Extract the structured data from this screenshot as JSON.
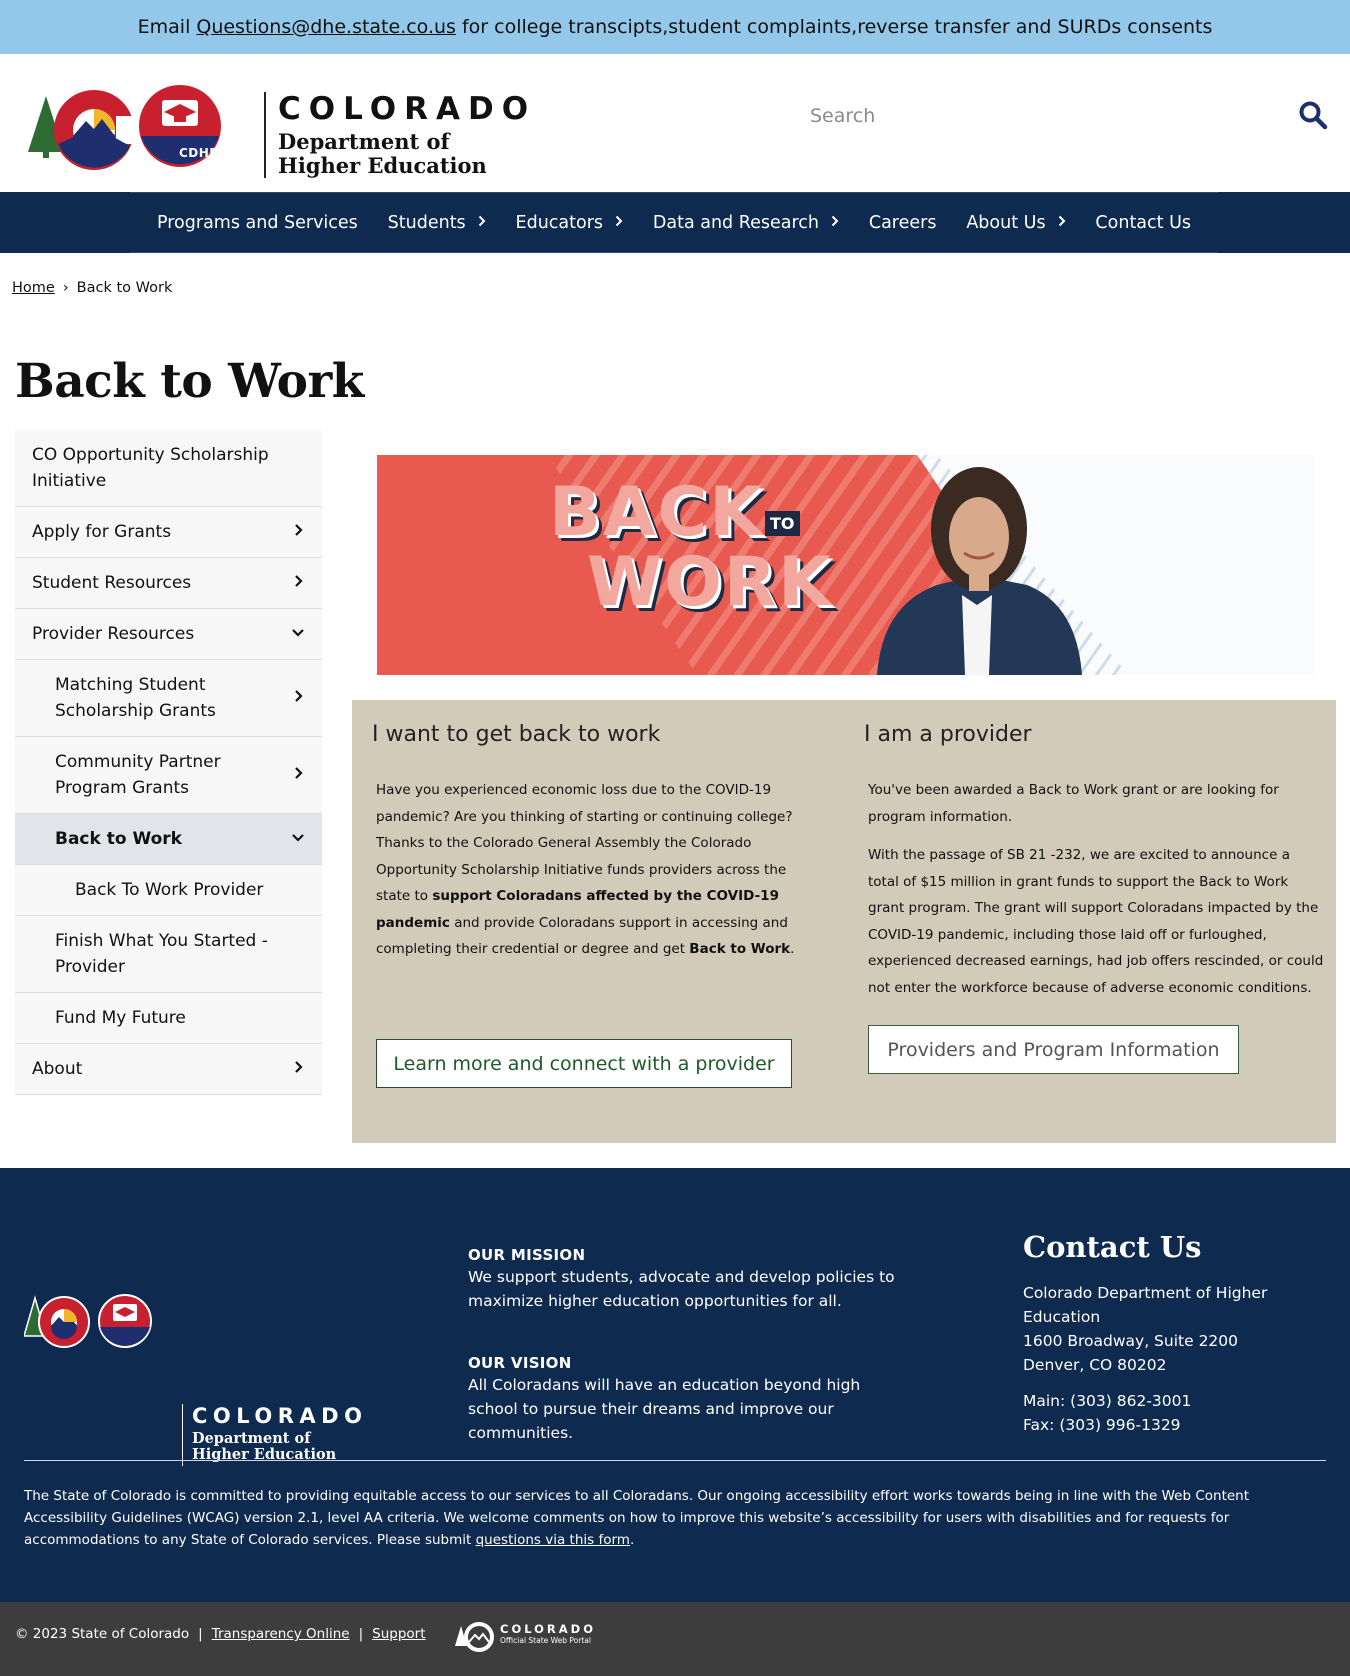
{
  "alert": {
    "prefix": "Email",
    "email": "Questions@dhe.state.co.us",
    "suffix": "for college transcipts,student complaints,reverse transfer and SURDs consents"
  },
  "header": {
    "logo_badge": "CDHE",
    "wordmark_state": "COLORADO",
    "wordmark_dept_line1": "Department of",
    "wordmark_dept_line2": "Higher Education",
    "search_placeholder": "Search",
    "colors": {
      "nav_bg": "#0e2a4f",
      "alert_bg": "#94c8ea",
      "brand_red": "#c8202f",
      "brand_navy": "#1f2e6e",
      "brand_gold": "#f2b62c",
      "brand_green": "#2e6b34"
    }
  },
  "nav": {
    "items": [
      {
        "label": "Programs and Services",
        "has_children": false
      },
      {
        "label": "Students",
        "has_children": true
      },
      {
        "label": "Educators",
        "has_children": true
      },
      {
        "label": "Data and Research",
        "has_children": true
      },
      {
        "label": "Careers",
        "has_children": false
      },
      {
        "label": "About Us",
        "has_children": true
      },
      {
        "label": "Contact Us",
        "has_children": false
      }
    ]
  },
  "breadcrumb": {
    "home": "Home",
    "separator": "›",
    "current": "Back to Work"
  },
  "page_title": "Back to Work",
  "sidebar": {
    "items": [
      {
        "label": "CO Opportunity Scholarship Initiative",
        "arrow": ""
      },
      {
        "label": "Apply for Grants",
        "arrow": "›"
      },
      {
        "label": "Student Resources",
        "arrow": "›"
      },
      {
        "label": "Provider Resources",
        "arrow": "⌄"
      },
      {
        "label": "Matching Student Scholarship Grants",
        "arrow": "›"
      },
      {
        "label": "Community Partner Program Grants",
        "arrow": "›"
      },
      {
        "label": "Back to Work",
        "arrow": "⌄"
      },
      {
        "label": "Back To Work Provider",
        "arrow": ""
      },
      {
        "label": "Finish What You Started - Provider",
        "arrow": ""
      },
      {
        "label": "Fund My Future",
        "arrow": ""
      },
      {
        "label": "About",
        "arrow": "›"
      }
    ]
  },
  "hero": {
    "word1": "BACK",
    "word2": "TO",
    "word3": "WORK"
  },
  "panel": {
    "left": {
      "heading": "I want to get back to work",
      "p1_a": "Have you experienced economic loss due to the COVID-19 pandemic? Are you thinking of starting or continuing college? Thanks to the Colorado General Assembly the Colorado Opportunity Scholarship Initiative  funds providers across the state to ",
      "p1_b": "support Coloradans affected by the COVID-19 pandemic",
      "p1_c": " and provide Coloradans support in accessing and completing their credential or degree and get ",
      "p1_d": "Back to Work",
      "p1_e": ".",
      "button": "Learn more and connect with a provider"
    },
    "right": {
      "heading": "I am a provider",
      "p1": "You've been awarded a Back to Work grant or are looking for program information.",
      "p2": "With the passage of SB 21 -232, we are excited to announce a total of $15 million in grant funds to support the Back to Work grant program. The grant will support Coloradans impacted by the COVID-19 pandemic, including those laid off or furloughed, experienced decreased earnings, had job offers rescinded, or could not enter the workforce because of adverse economic conditions.",
      "button": "Providers and Program Information"
    }
  },
  "footer": {
    "mission_heading": "OUR MISSION",
    "mission_text": "We support students, advocate and develop policies to maximize higher education opportunities for all.",
    "vision_heading": "OUR VISION",
    "vision_text": "All Coloradans will have an education beyond high school to pursue their dreams and improve our communities.",
    "contact_heading": "Contact Us",
    "contact_org": "Colorado Department of Higher Education",
    "contact_street": "1600 Broadway, Suite 2200",
    "contact_city": "Denver, CO 80202",
    "contact_main": "Main: (303) 862-3001",
    "contact_fax": "Fax: (303) 996-1329",
    "access_text": "The State of Colorado is committed to providing equitable access to our services to all Coloradans. Our ongoing accessibility effort works towards being in line with the Web Content Accessibility Guidelines (WCAG) version 2.1, level AA criteria. We welcome comments on how to improve this website’s accessibility for users with disabilities and for requests for accommodations to any State of Colorado services. Please submit ",
    "access_link": "questions via this form",
    "access_end": ".",
    "copyright": "© 2023 State of Colorado",
    "sep": "|",
    "transparency": "Transparency Online",
    "support": "Support",
    "portal_name": "COLORADO",
    "portal_sub": "Official State Web Portal"
  }
}
